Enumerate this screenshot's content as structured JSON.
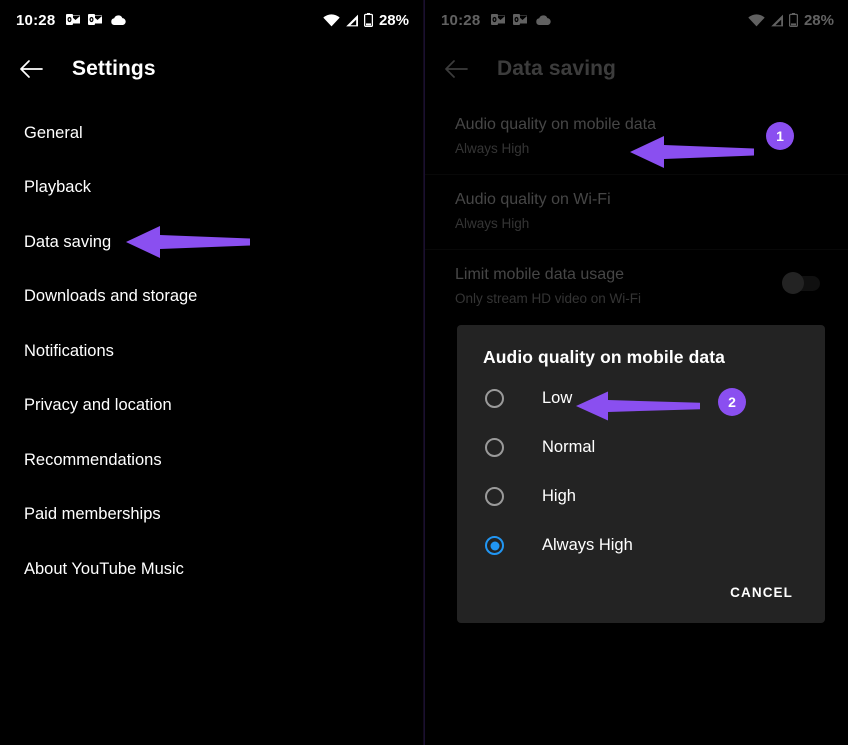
{
  "colors": {
    "accent_purple": "#8a4ff0",
    "radio_selected_blue": "#2196f3",
    "screen_background": "#000000",
    "dialog_background": "#232323"
  },
  "status_bar": {
    "time": "10:28",
    "battery_percent": "28%",
    "icons": [
      "outlook-icon",
      "outlook-icon",
      "cloud-icon",
      "wifi-icon",
      "cellular-signal-icon",
      "battery-icon"
    ]
  },
  "left_screen": {
    "appbar": {
      "back_icon": "back-arrow-icon",
      "title": "Settings"
    },
    "items": [
      {
        "label": "General"
      },
      {
        "label": "Playback"
      },
      {
        "label": "Data saving"
      },
      {
        "label": "Downloads and storage"
      },
      {
        "label": "Notifications"
      },
      {
        "label": "Privacy and location"
      },
      {
        "label": "Recommendations"
      },
      {
        "label": "Paid memberships"
      },
      {
        "label": "About YouTube Music"
      }
    ]
  },
  "right_screen": {
    "appbar": {
      "back_icon": "back-arrow-icon",
      "title": "Data saving"
    },
    "rows": [
      {
        "title": "Audio quality on mobile data",
        "subtitle": "Always High"
      },
      {
        "title": "Audio quality on Wi-Fi",
        "subtitle": "Always High"
      },
      {
        "title": "Limit mobile data usage",
        "subtitle": "Only stream HD video on Wi-Fi",
        "toggle": "off"
      }
    ],
    "dialog": {
      "title": "Audio quality on mobile data",
      "options": [
        {
          "label": "Low",
          "selected": false
        },
        {
          "label": "Normal",
          "selected": false
        },
        {
          "label": "High",
          "selected": false
        },
        {
          "label": "Always High",
          "selected": true
        }
      ],
      "cancel_label": "CANCEL"
    }
  },
  "annotations": [
    {
      "number": "1",
      "points_to": "Audio quality on mobile data"
    },
    {
      "number": "2",
      "points_to": "Low"
    }
  ]
}
